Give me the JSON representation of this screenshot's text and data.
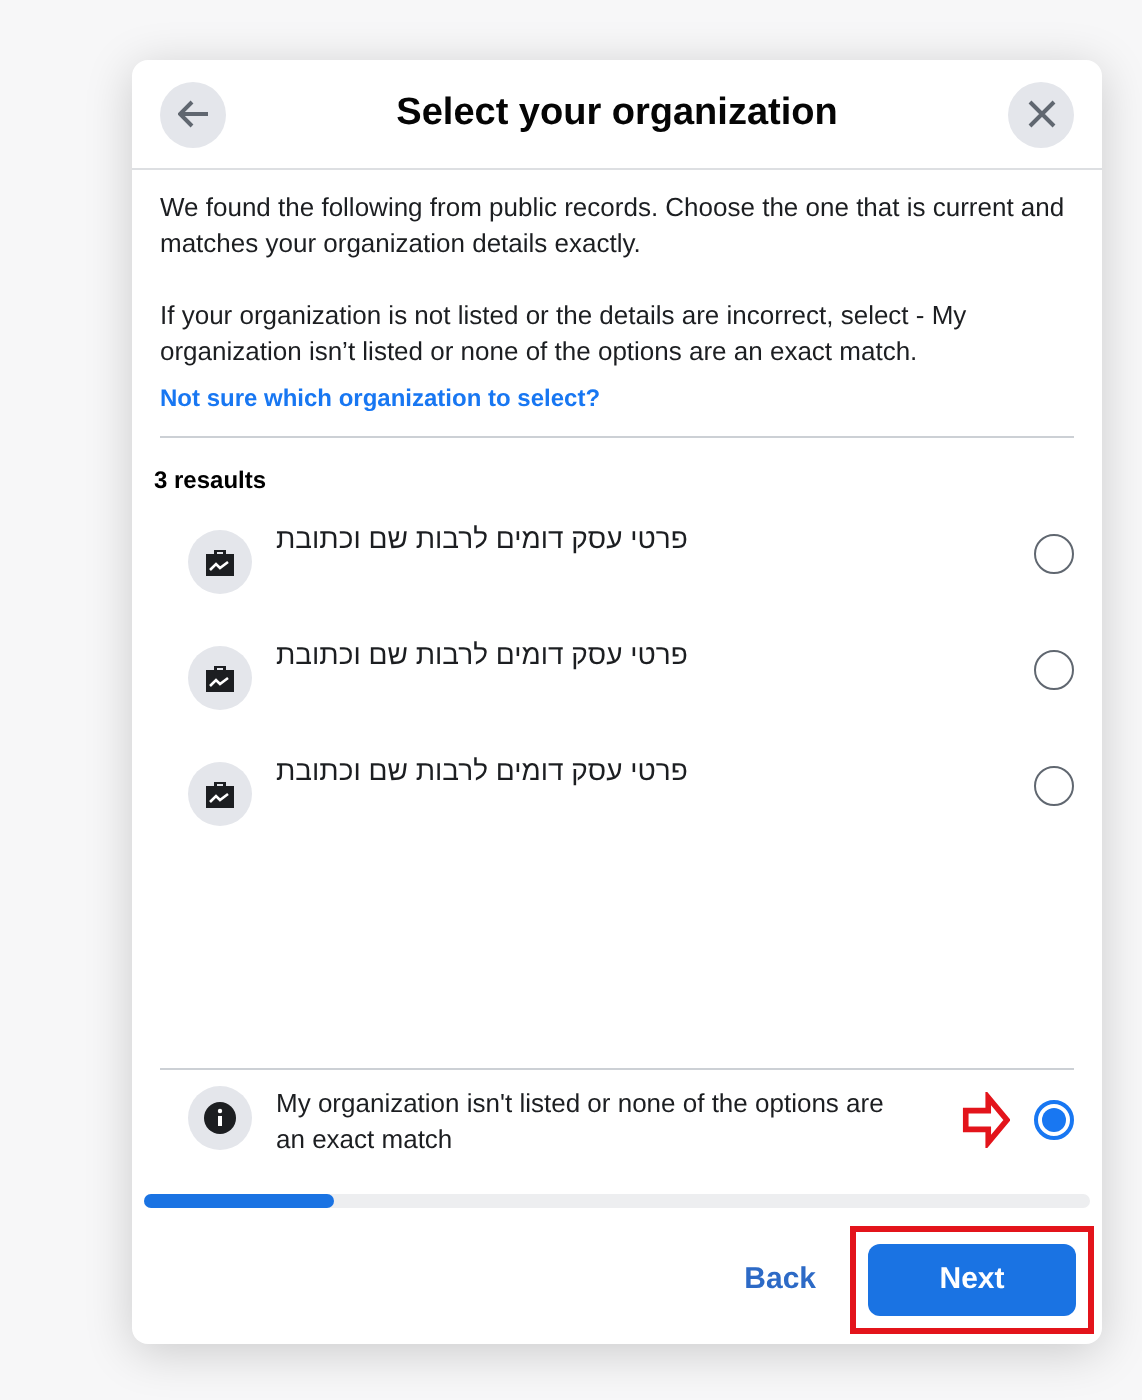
{
  "dialog": {
    "title": "Select your organization",
    "intro": "We found the following from public records. Choose the one that is current and matches your organization details exactly.",
    "note": "If your organization is not listed or the details are incorrect, select - My organization isn’t listed or none of the options are an exact match.",
    "help_link": "Not sure which organization to select?",
    "results_count": "3 resaults",
    "results": [
      {
        "name": "פרטי עסק דומים לרבות שם וכתובת",
        "selected": false
      },
      {
        "name": "פרטי עסק דומים לרבות שם וכתובת",
        "selected": false
      },
      {
        "name": "פרטי עסק דומים לרבות שם וכתובת",
        "selected": false
      }
    ],
    "none_option": {
      "label": "My organization isn't listed or none of the options are an exact match",
      "selected": true
    },
    "progress": {
      "level": 0.2
    },
    "buttons": {
      "back": "Back",
      "next": "Next"
    }
  }
}
